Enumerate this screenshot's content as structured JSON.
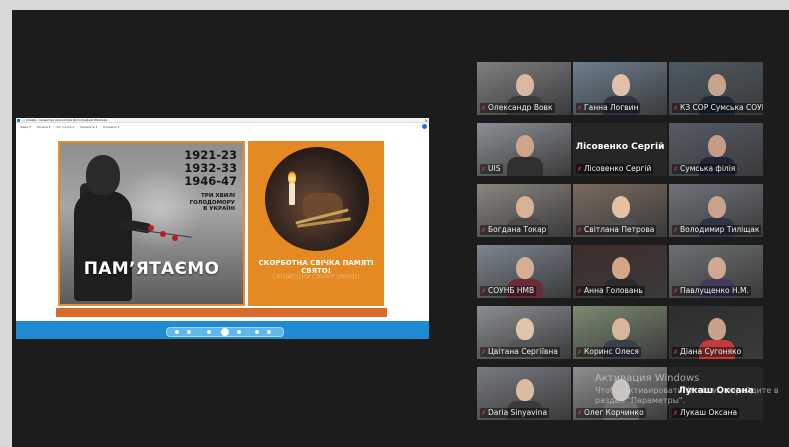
{
  "shared_screen": {
    "window_title": "— Слайд – Средство просмотра фотографий Windows",
    "menu": [
      "Файл ▾",
      "Печать ▾",
      "Эл. почта ▾",
      "Записать ▾",
      "Открыть ▾"
    ],
    "slide_left": {
      "years": [
        "1921-23",
        "1932-33",
        "1946-47"
      ],
      "subtitle": [
        "ТРИ ХВИЛІ",
        "ГОЛОДОМОРУ",
        "В УКРАЇНІ"
      ],
      "headline": "ПАМ’ЯТАЄМО"
    },
    "slide_right": {
      "caption_line1": "СКОРБОТНА СВІЧКА ПАМЯТІ",
      "caption_line2": "СВЯТО!"
    }
  },
  "gallery": {
    "participants": [
      {
        "name": "Олександр Вовк",
        "active": false,
        "big": ""
      },
      {
        "name": "Ганна Логвин",
        "active": false,
        "big": ""
      },
      {
        "name": "КЗ СОР Сумська СОУНБ",
        "active": true,
        "big": ""
      },
      {
        "name": "UIS",
        "active": false,
        "big": ""
      },
      {
        "name": "Лісовенко Сергій",
        "active": false,
        "big": "Лісовенко Сергій"
      },
      {
        "name": "Сумська філія",
        "active": false,
        "big": ""
      },
      {
        "name": "Богдана Токар",
        "active": false,
        "big": ""
      },
      {
        "name": "Світлана Петрова",
        "active": false,
        "big": ""
      },
      {
        "name": "Володимир Тиліщак",
        "active": false,
        "big": ""
      },
      {
        "name": "СОУНБ НМВ",
        "active": false,
        "big": ""
      },
      {
        "name": "Анна Головань",
        "active": false,
        "big": ""
      },
      {
        "name": "Павлущенко Н.М.",
        "active": false,
        "big": ""
      },
      {
        "name": "Цвітана Сергіївна",
        "active": false,
        "big": ""
      },
      {
        "name": "Коринс Олеся",
        "active": false,
        "big": ""
      },
      {
        "name": "Діана Сугоняко",
        "active": false,
        "big": ""
      },
      {
        "name": "Daria Sinyavina",
        "active": false,
        "big": ""
      },
      {
        "name": "Олег Корчинко",
        "active": false,
        "big": ""
      },
      {
        "name": "Лукаш Оксана",
        "active": false,
        "big": "Лукаш Оксана"
      }
    ]
  },
  "watermark": {
    "title": "Активация Windows",
    "subtitle": "Чтобы активировать Windows, перейдите в раздел \"Параметры\"."
  },
  "colors": {
    "active_outline": "#b9d84a",
    "slide_orange": "#e58a22",
    "toolbar_blue": "#1f8bd4",
    "mic_muted": "#e23a3a"
  }
}
